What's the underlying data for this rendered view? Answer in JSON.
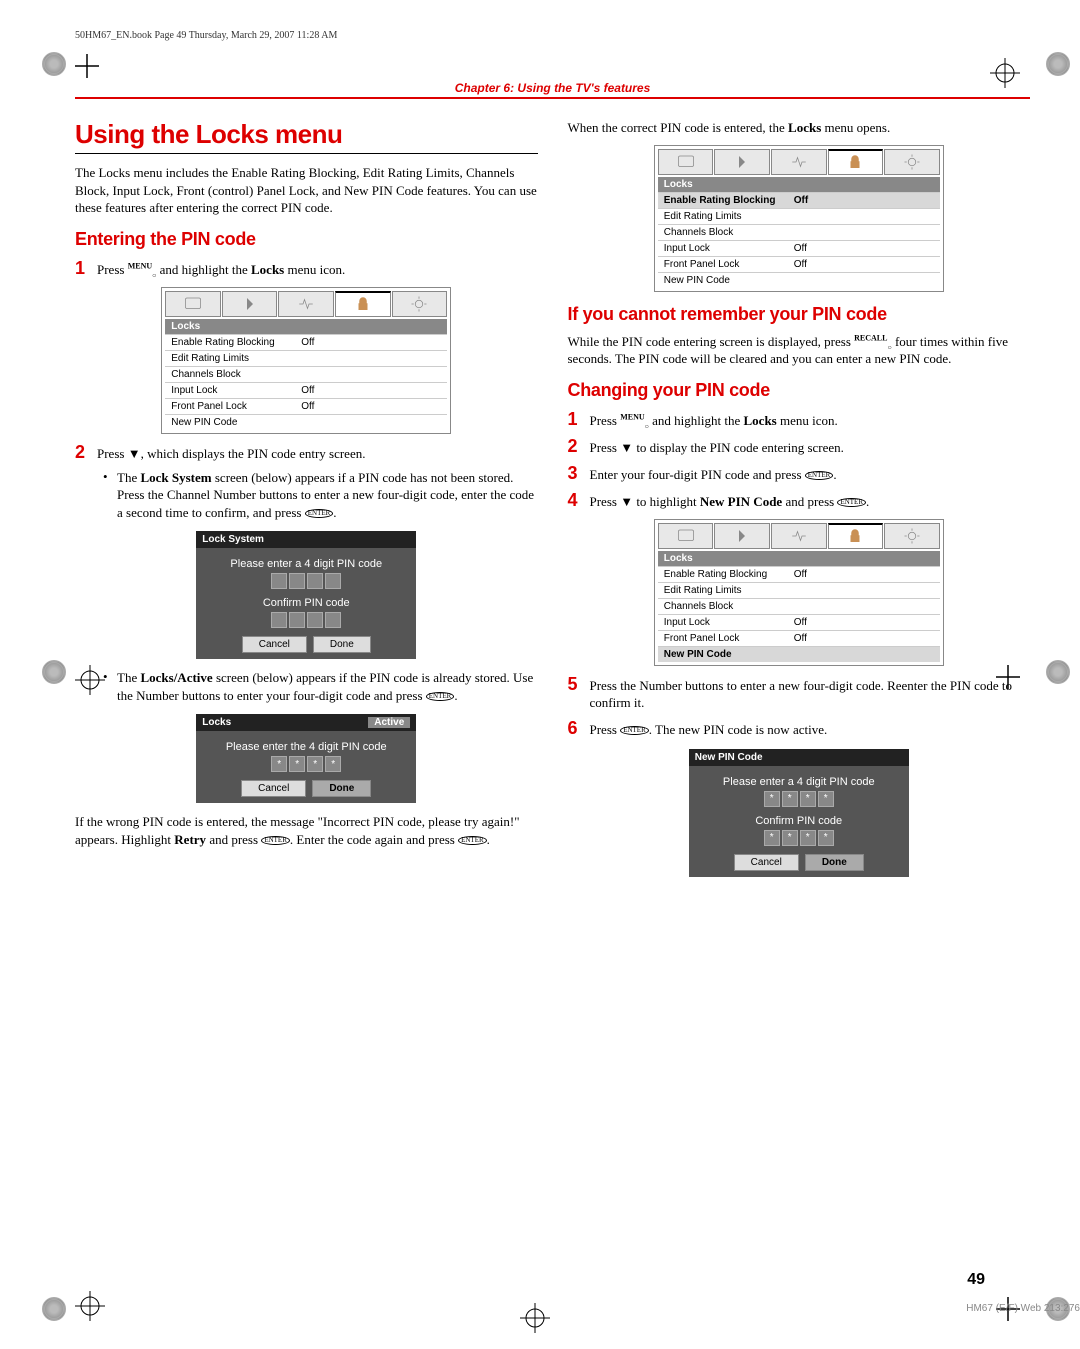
{
  "header_line": "50HM67_EN.book  Page 49  Thursday, March 29, 2007  11:28 AM",
  "chapter_title": "Chapter 6: Using the TV's features",
  "h1": "Using the Locks menu",
  "intro_para": "The Locks menu includes the Enable Rating Blocking, Edit Rating Limits, Channels Block, Input Lock, Front (control) Panel Lock, and New PIN Code features. You can use these features after entering the correct PIN code.",
  "h2_enter": "Entering the PIN code",
  "step1_a": "Press ",
  "step1_key": "MENU",
  "step1_b": " and highlight the ",
  "step1_bold": "Locks",
  "step1_c": " menu icon.",
  "menu1": {
    "title": "Locks",
    "rows": [
      {
        "label": "Enable Rating Blocking",
        "val": "Off",
        "sel": false
      },
      {
        "label": "Edit Rating Limits",
        "val": "",
        "sel": false
      },
      {
        "label": "Channels Block",
        "val": "",
        "sel": false
      },
      {
        "label": "Input Lock",
        "val": "Off",
        "sel": false
      },
      {
        "label": "Front Panel Lock",
        "val": "Off",
        "sel": false
      },
      {
        "label": "New PIN Code",
        "val": "",
        "sel": false
      }
    ]
  },
  "step2": "Press ▼, which displays the PIN code entry screen.",
  "bullet1_a": "The ",
  "bullet1_bold": "Lock System",
  "bullet1_b": " screen (below) appears if a PIN code has not been stored. Press the Channel Number buttons to enter a new four-digit code, enter the code a second time to confirm, and press ",
  "dialog1": {
    "title": "Lock System",
    "line1": "Please enter a 4 digit PIN code",
    "line2": "Confirm PIN code",
    "btn1": "Cancel",
    "btn2": "Done"
  },
  "bullet2_a": "The ",
  "bullet2_bold": "Locks/Active",
  "bullet2_b": " screen (below) appears if the PIN code is already stored. Use the Number buttons to enter your four-digit code and press ",
  "dialog2": {
    "title_l": "Locks",
    "title_r": "Active",
    "line1": "Please enter the 4 digit PIN code",
    "btn1": "Cancel",
    "btn2": "Done"
  },
  "wrong_pin_a": "If the wrong PIN code is entered, the message \"Incorrect PIN code, please try again!\" appears. Highlight ",
  "wrong_pin_bold": "Retry",
  "wrong_pin_b": " and press ",
  "wrong_pin_c": ". Enter the code again and press ",
  "right_intro_a": "When the correct PIN code is entered, the ",
  "right_intro_bold": "Locks",
  "right_intro_b": " menu opens.",
  "menu2": {
    "title": "Locks",
    "rows": [
      {
        "label": "Enable Rating Blocking",
        "val": "Off",
        "sel": true
      },
      {
        "label": "Edit Rating Limits",
        "val": "",
        "sel": false
      },
      {
        "label": "Channels Block",
        "val": "",
        "sel": false
      },
      {
        "label": "Input Lock",
        "val": "Off",
        "sel": false
      },
      {
        "label": "Front Panel Lock",
        "val": "Off",
        "sel": false
      },
      {
        "label": "New PIN Code",
        "val": "",
        "sel": false
      }
    ]
  },
  "h2_forgot": "If you cannot remember your PIN code",
  "forgot_a": "While the PIN code entering screen is displayed, press ",
  "forgot_key": "RECALL",
  "forgot_b": " four times within five seconds. The PIN code will be cleared and you can enter a new PIN code.",
  "h2_change": "Changing your PIN code",
  "cstep1_a": "Press ",
  "cstep1_key": "MENU",
  "cstep1_b": " and highlight the ",
  "cstep1_bold": "Locks",
  "cstep1_c": " menu icon.",
  "cstep2": "Press ▼ to display the PIN code entering screen.",
  "cstep3_a": "Enter your four-digit PIN code and press ",
  "cstep4_a": "Press ▼ to highlight ",
  "cstep4_bold": "New PIN Code",
  "cstep4_b": " and press ",
  "menu3": {
    "title": "Locks",
    "rows": [
      {
        "label": "Enable Rating Blocking",
        "val": "Off",
        "sel": false
      },
      {
        "label": "Edit Rating Limits",
        "val": "",
        "sel": false
      },
      {
        "label": "Channels Block",
        "val": "",
        "sel": false
      },
      {
        "label": "Input Lock",
        "val": "Off",
        "sel": false
      },
      {
        "label": "Front Panel Lock",
        "val": "Off",
        "sel": false
      },
      {
        "label": "New PIN Code",
        "val": "",
        "sel": true
      }
    ]
  },
  "cstep5": "Press the Number buttons to enter a new four-digit code. Reenter the PIN code to confirm it.",
  "cstep6_a": "Press ",
  "cstep6_b": ". The new PIN code is now active.",
  "dialog3": {
    "title": "New PIN Code",
    "line1": "Please enter a 4 digit PIN code",
    "line2": "Confirm PIN code",
    "btn1": "Cancel",
    "btn2": "Done"
  },
  "page_num": "49",
  "footer_code": "HM67 (E/F) Web 213:276",
  "enter_label": "ENTER"
}
